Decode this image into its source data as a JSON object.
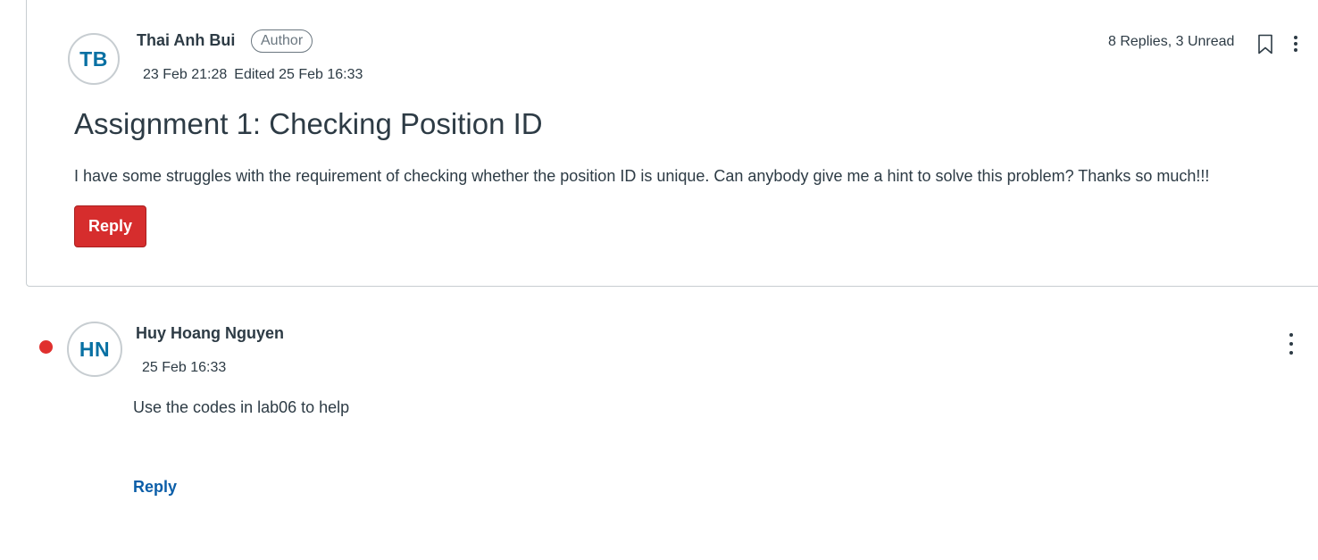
{
  "post": {
    "author": {
      "initials": "TB",
      "name": "Thai Anh Bui",
      "badge": "Author"
    },
    "created": "23 Feb 21:28",
    "edited": "Edited 25 Feb 16:33",
    "replies_summary": "8 Replies, 3 Unread",
    "title": "Assignment 1: Checking Position ID",
    "body": "I have some struggles with the requirement of checking whether the position ID is unique. Can anybody give me a hint to solve this problem? Thanks so much!!!",
    "reply_label": "Reply"
  },
  "replies": [
    {
      "author": {
        "initials": "HN",
        "name": "Huy Hoang Nguyen"
      },
      "created": "25 Feb 16:33",
      "unread": true,
      "body": "Use the codes in lab06 to help",
      "reply_label": "Reply"
    }
  ],
  "icons": {
    "bookmark": "bookmark-icon",
    "more": "more-options-icon",
    "unread": "unread-indicator"
  },
  "colors": {
    "primary_button": "#d62d2d",
    "link": "#0b5ea8",
    "avatar_text": "#0770a3",
    "unread_dot": "#e0302e"
  }
}
